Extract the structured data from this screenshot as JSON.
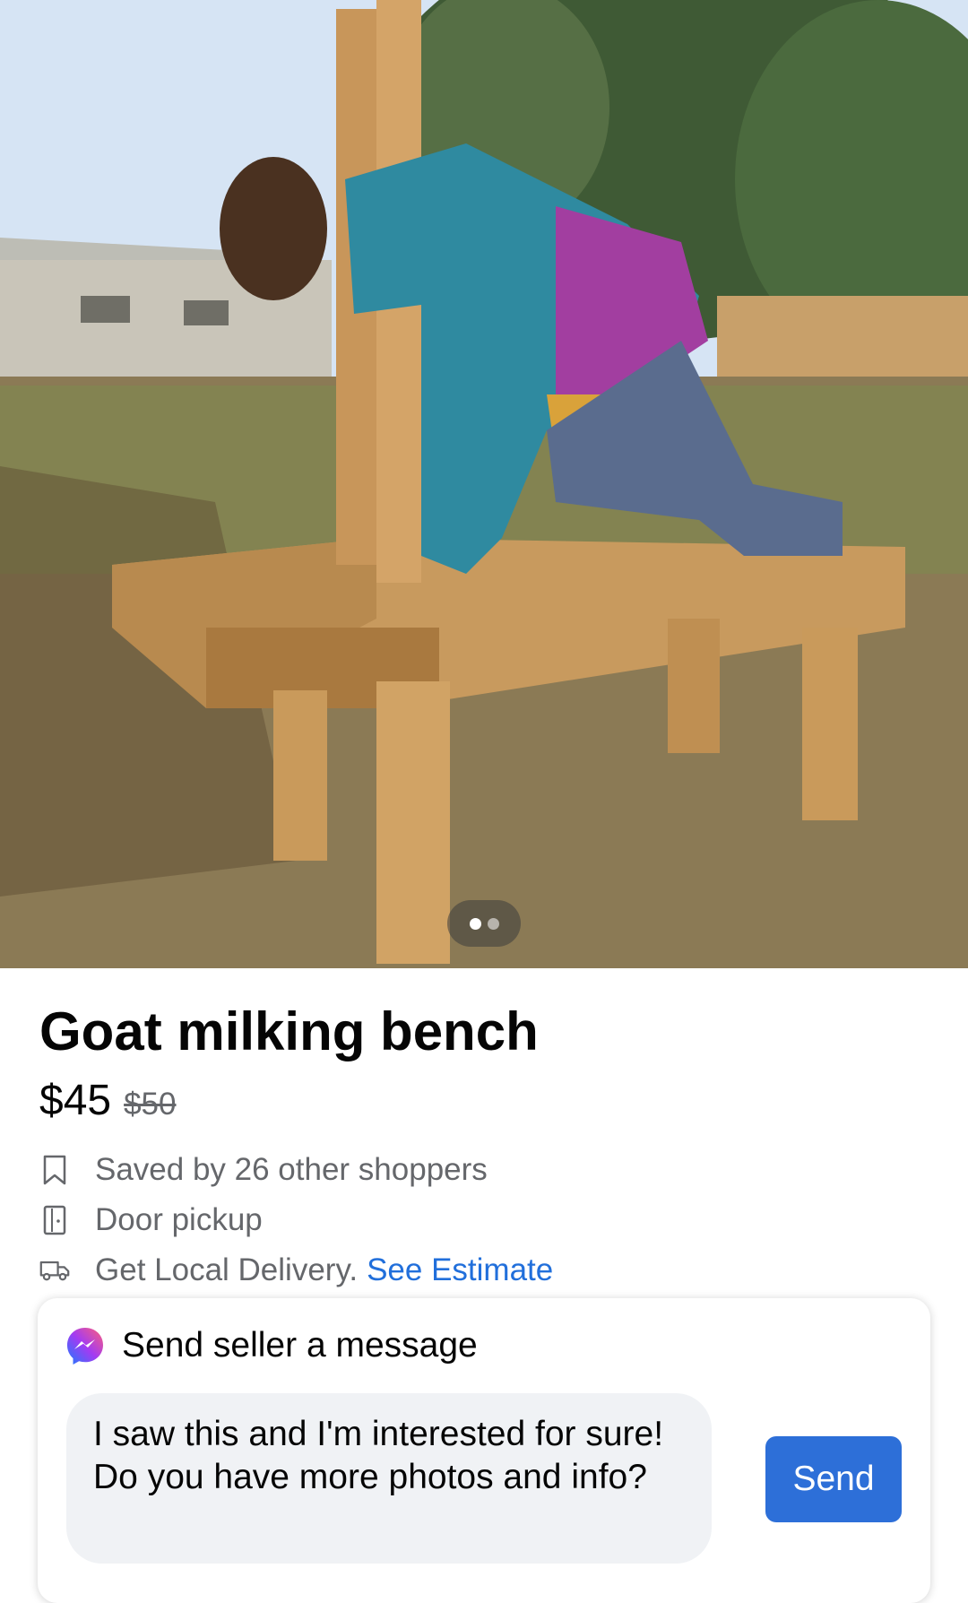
{
  "photo": {
    "carousel_count": 2,
    "active_index": 0
  },
  "listing": {
    "title": "Goat milking bench",
    "price": "$45",
    "original_price": "$50"
  },
  "details": [
    {
      "icon": "bookmark-icon",
      "text": "Saved by 26 other shoppers"
    },
    {
      "icon": "door-icon",
      "text": "Door pickup"
    },
    {
      "icon": "truck-icon",
      "text": "Get Local Delivery.",
      "link": "See Estimate"
    }
  ],
  "message": {
    "icon": "messenger-icon",
    "heading": "Send seller a message",
    "text": "I saw this and I'm interested for sure! Do you have more photos and info?",
    "send_label": "Send"
  },
  "colors": {
    "link": "#216fdb",
    "send_button": "#2d6fd8",
    "bubble": "#f0f2f5",
    "secondary_text": "#65676b"
  }
}
